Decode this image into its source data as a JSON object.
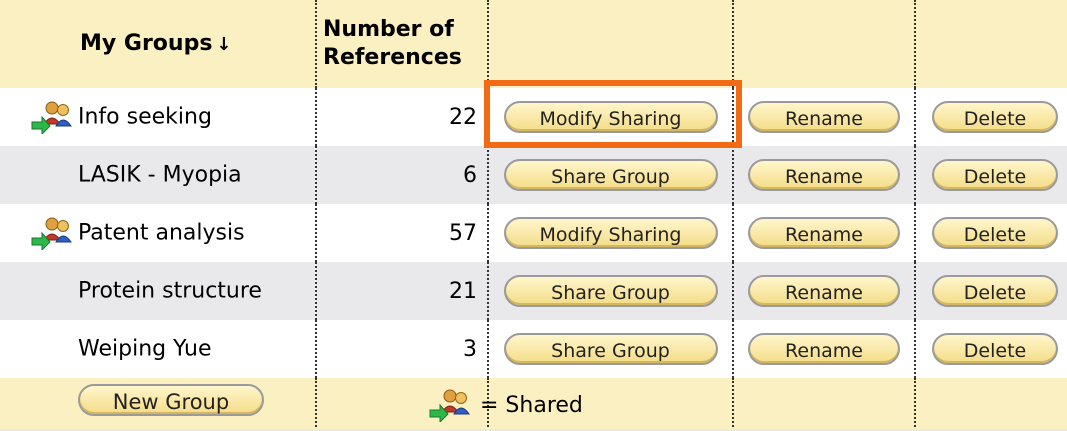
{
  "header": {
    "groups_label": "My Groups",
    "sort_arrow": "↓",
    "refs_label_line1": "Number of",
    "refs_label_line2": "References"
  },
  "rows": [
    {
      "name": "Info seeking",
      "refs": "22",
      "shared": true,
      "share_button": "Modify Sharing",
      "rename_button": "Rename",
      "delete_button": "Delete"
    },
    {
      "name": "LASIK - Myopia",
      "refs": "6",
      "shared": false,
      "share_button": "Share Group",
      "rename_button": "Rename",
      "delete_button": "Delete"
    },
    {
      "name": "Patent analysis",
      "refs": "57",
      "shared": true,
      "share_button": "Modify Sharing",
      "rename_button": "Rename",
      "delete_button": "Delete"
    },
    {
      "name": "Protein structure",
      "refs": "21",
      "shared": false,
      "share_button": "Share Group",
      "rename_button": "Rename",
      "delete_button": "Delete"
    },
    {
      "name": "Weiping Yue",
      "refs": "3",
      "shared": false,
      "share_button": "Share Group",
      "rename_button": "Rename",
      "delete_button": "Delete"
    }
  ],
  "footer": {
    "new_group_button": "New Group",
    "legend_text": "= Shared"
  },
  "icons": {
    "shared": "shared-group-icon"
  },
  "colors": {
    "header_bg": "#fbf0c2",
    "alt_row_bg": "#e9e9ec",
    "button_fill": "#f4dc86",
    "highlight": "#f26a14"
  }
}
